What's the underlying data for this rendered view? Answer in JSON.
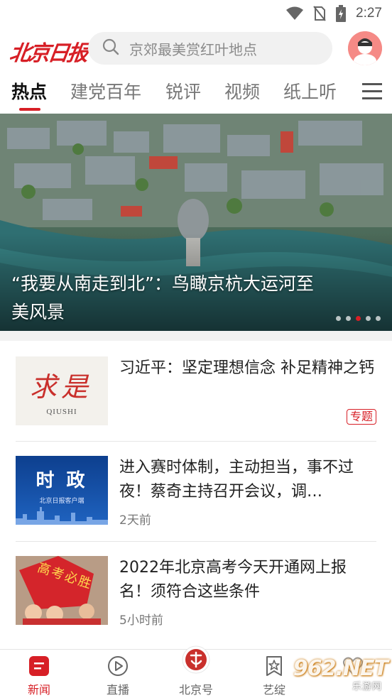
{
  "status_bar": {
    "time": "2:27",
    "icons": [
      "wifi-icon",
      "no-sim-icon",
      "battery-charging-icon"
    ]
  },
  "header": {
    "logo_text": "北京日报",
    "search_placeholder": "京郊最美赏红叶地点",
    "icons": [
      "search-icon",
      "avatar-icon"
    ]
  },
  "tabs": {
    "items": [
      "热点",
      "建党百年",
      "锐评",
      "视频",
      "纸上听"
    ],
    "active": "热点",
    "menu_icon": "menu-icon"
  },
  "banner": {
    "caption": "“我要从南走到北”：鸟瞰京杭大运河至美风景",
    "slide_count": 5,
    "active_slide": 3
  },
  "articles": [
    {
      "title": "习近平：坚定理想信念 补足精神之钙",
      "thumb_text": "求是",
      "thumb_sub": "QIUSHI",
      "badge": "专题",
      "meta": ""
    },
    {
      "title": "进入赛时体制，主动担当，事不过夜！蔡奇主持召开会议，调…",
      "thumb_text": "时 政",
      "thumb_sub": "北京日报客户端",
      "meta": "2天前"
    },
    {
      "title": "2022年北京高考今天开通网上报名！须符合这些条件",
      "thumb_text": "高考必胜",
      "meta": "5小时前"
    }
  ],
  "bottom_nav": [
    {
      "label": "新闻",
      "icon": "news-icon",
      "active": true
    },
    {
      "label": "直播",
      "icon": "play-icon",
      "active": false
    },
    {
      "label": "北京号",
      "icon": "beijing-logo-icon",
      "active": false
    },
    {
      "label": "艺绽",
      "icon": "star-bookmark-icon",
      "active": false
    },
    {
      "label": "",
      "icon": "heart-icon",
      "active": false
    }
  ],
  "watermark": {
    "text": "962.NET",
    "sub": "乐游网"
  },
  "colors": {
    "brand_red": "#d71f26",
    "search_bg": "#f1f1f1",
    "text_gray": "#777777"
  }
}
